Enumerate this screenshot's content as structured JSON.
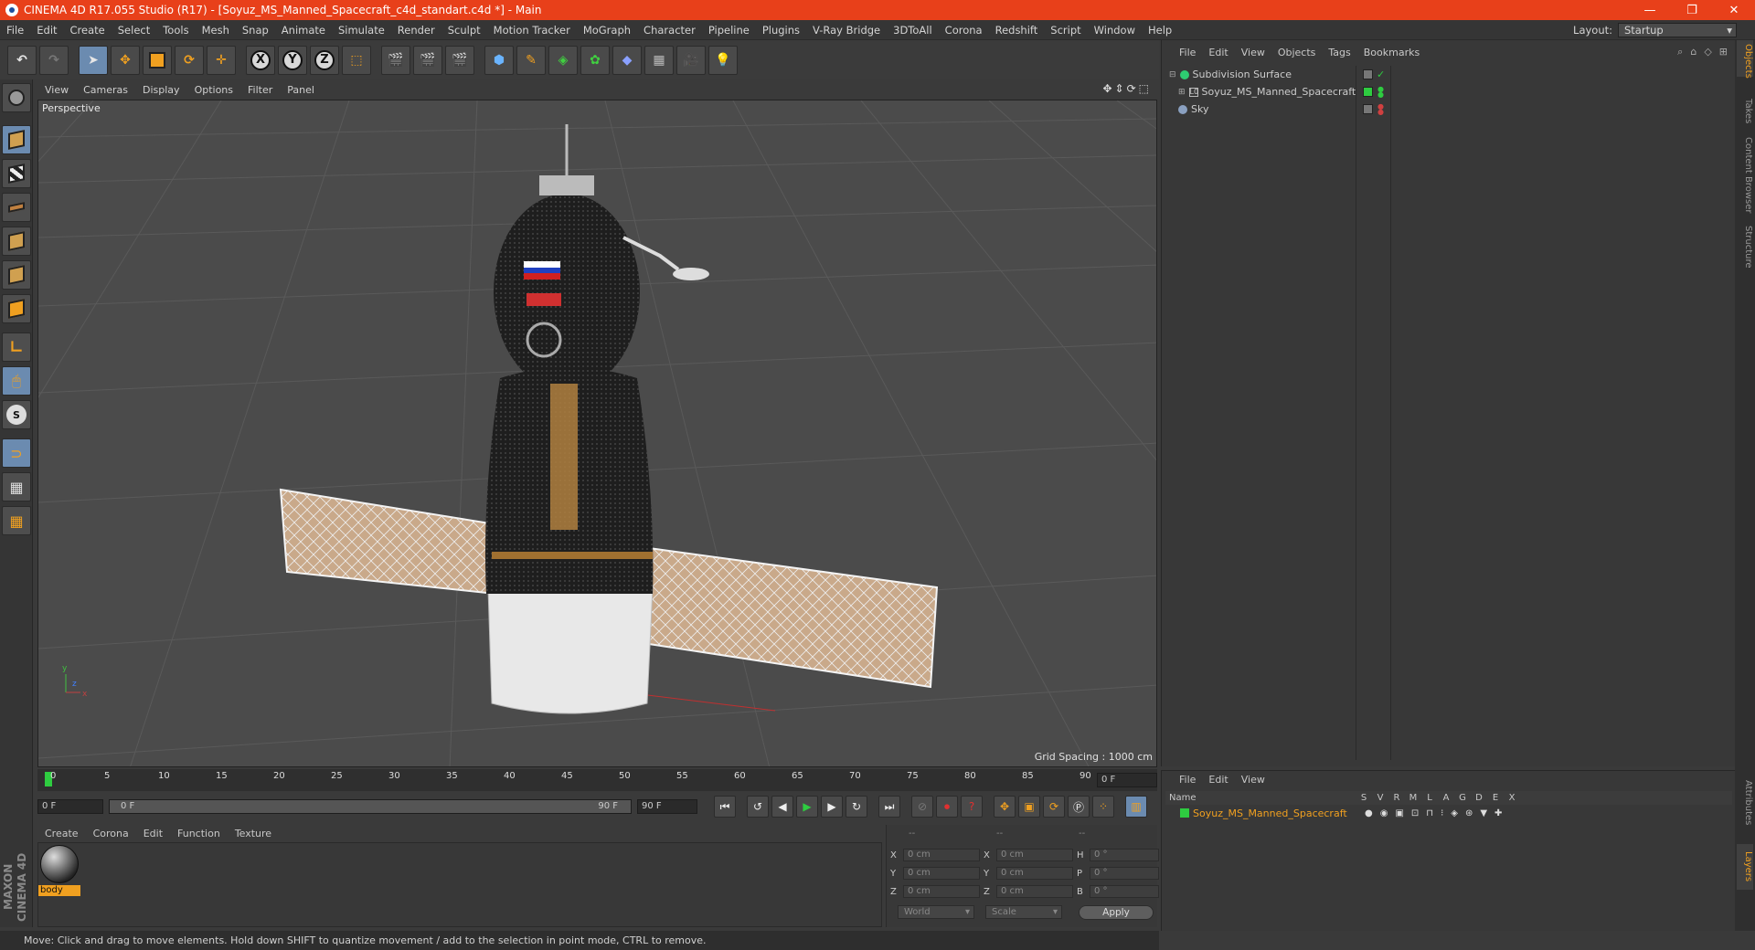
{
  "window": {
    "title": "CINEMA 4D R17.055 Studio (R17) - [Soyuz_MS_Manned_Spacecraft_c4d_standart.c4d *] - Main",
    "controls": [
      "—",
      "❐",
      "✕"
    ]
  },
  "menubar": {
    "items": [
      "File",
      "Edit",
      "Create",
      "Select",
      "Tools",
      "Mesh",
      "Snap",
      "Animate",
      "Simulate",
      "Render",
      "Sculpt",
      "Motion Tracker",
      "MoGraph",
      "Character",
      "Pipeline",
      "Plugins",
      "V-Ray Bridge",
      "3DToAll",
      "Corona",
      "Redshift",
      "Script",
      "Window",
      "Help"
    ],
    "layout_label": "Layout:",
    "layout_value": "Startup"
  },
  "toolbar": {
    "axis_labels": [
      "X",
      "Y",
      "Z"
    ]
  },
  "viewport": {
    "menu": [
      "View",
      "Cameras",
      "Display",
      "Options",
      "Filter",
      "Panel"
    ],
    "label": "Perspective",
    "grid_spacing": "Grid Spacing : 1000 cm",
    "axis_x": "x",
    "axis_y": "y",
    "axis_z": "z"
  },
  "timeline": {
    "ticks": [
      "0",
      "5",
      "10",
      "15",
      "20",
      "25",
      "30",
      "35",
      "40",
      "45",
      "50",
      "55",
      "60",
      "65",
      "70",
      "75",
      "80",
      "85",
      "90"
    ],
    "current_frame": "0 F",
    "start_field": "0 F",
    "range_start": "0 F",
    "range_end": "90 F",
    "end_field": "90 F"
  },
  "material_manager": {
    "menu": [
      "Create",
      "Corona",
      "Edit",
      "Function",
      "Texture"
    ],
    "material_name": "body"
  },
  "coordinates": {
    "headers": [
      "--",
      "--",
      "--"
    ],
    "rows": [
      {
        "a": "X",
        "av": "0 cm",
        "b": "X",
        "bv": "0 cm",
        "c": "H",
        "cv": "0 °"
      },
      {
        "a": "Y",
        "av": "0 cm",
        "b": "Y",
        "bv": "0 cm",
        "c": "P",
        "cv": "0 °"
      },
      {
        "a": "Z",
        "av": "0 cm",
        "b": "Z",
        "bv": "0 cm",
        "c": "B",
        "cv": "0 °"
      }
    ],
    "space": "World",
    "mode": "Scale",
    "apply": "Apply"
  },
  "status": {
    "text": "Move: Click and drag to move elements. Hold down SHIFT to quantize movement / add to the selection in point mode, CTRL to remove."
  },
  "branding": {
    "text": "MAXON CINEMA 4D"
  },
  "object_manager": {
    "menu": [
      "File",
      "Edit",
      "View",
      "Objects",
      "Tags",
      "Bookmarks"
    ],
    "objects": [
      {
        "name": "Subdivision Surface"
      },
      {
        "name": "Soyuz_MS_Manned_Spacecraft"
      },
      {
        "name": "Sky"
      }
    ]
  },
  "layer_manager": {
    "menu": [
      "File",
      "Edit",
      "View"
    ],
    "columns": [
      "Name",
      "S",
      "V",
      "R",
      "M",
      "L",
      "A",
      "G",
      "D",
      "E",
      "X"
    ],
    "layer_name": "Soyuz_MS_Manned_Spacecraft"
  },
  "right_tabs": [
    "Objects",
    "Takes",
    "Content Browser",
    "Structure",
    "Attributes",
    "Layers"
  ],
  "colors": {
    "title_bar": "#e8401a",
    "accent": "#f0a020",
    "active_green": "#2ecc40"
  }
}
